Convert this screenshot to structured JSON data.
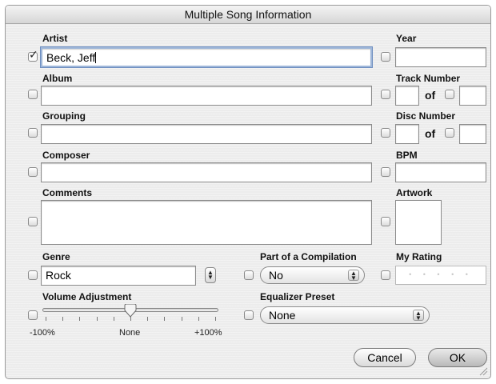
{
  "window": {
    "title": "Multiple Song Information"
  },
  "artist": {
    "label": "Artist",
    "value": "Beck, Jeff",
    "checked": true
  },
  "year": {
    "label": "Year",
    "value": ""
  },
  "album": {
    "label": "Album",
    "value": ""
  },
  "track": {
    "label": "Track Number",
    "of": "of",
    "value": "",
    "total": ""
  },
  "grouping": {
    "label": "Grouping",
    "value": ""
  },
  "disc": {
    "label": "Disc Number",
    "of": "of",
    "value": "",
    "total": ""
  },
  "composer": {
    "label": "Composer",
    "value": ""
  },
  "bpm": {
    "label": "BPM",
    "value": ""
  },
  "comments": {
    "label": "Comments",
    "value": ""
  },
  "artwork": {
    "label": "Artwork"
  },
  "genre": {
    "label": "Genre",
    "value": "Rock"
  },
  "compilation": {
    "label": "Part of a Compilation",
    "value": "No"
  },
  "rating": {
    "label": "My Rating",
    "stars": 0,
    "max": 5,
    "placeholder_dots": "• • • • •"
  },
  "volume": {
    "label": "Volume Adjustment",
    "min_label": "-100%",
    "mid_label": "None",
    "max_label": "+100%",
    "value_percent": 0
  },
  "equalizer": {
    "label": "Equalizer Preset",
    "value": "None"
  },
  "buttons": {
    "cancel": "Cancel",
    "ok": "OK"
  }
}
